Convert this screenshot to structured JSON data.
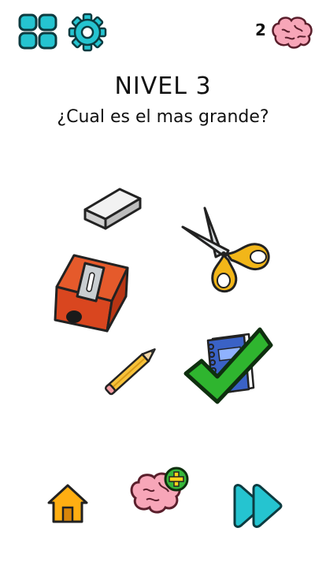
{
  "header": {
    "brain_count": "2",
    "icons": [
      "menu-grid-icon",
      "settings-gear-icon",
      "brain-icon"
    ]
  },
  "level": {
    "title": "NIVEL 3",
    "question": "¿Cual es el mas grande?"
  },
  "items": [
    "eraser",
    "scissors",
    "pencil-sharpener",
    "pencil",
    "notebook"
  ],
  "selected_item": "notebook",
  "footer": {
    "icons": [
      "home-icon",
      "brain-hint-icon",
      "skip-forward-icon"
    ]
  },
  "colors": {
    "teal": "#25c4d0",
    "correct_green": "#2fb52f",
    "home_orange": "#ffae12",
    "brain_pink": "#f7a6b8"
  }
}
